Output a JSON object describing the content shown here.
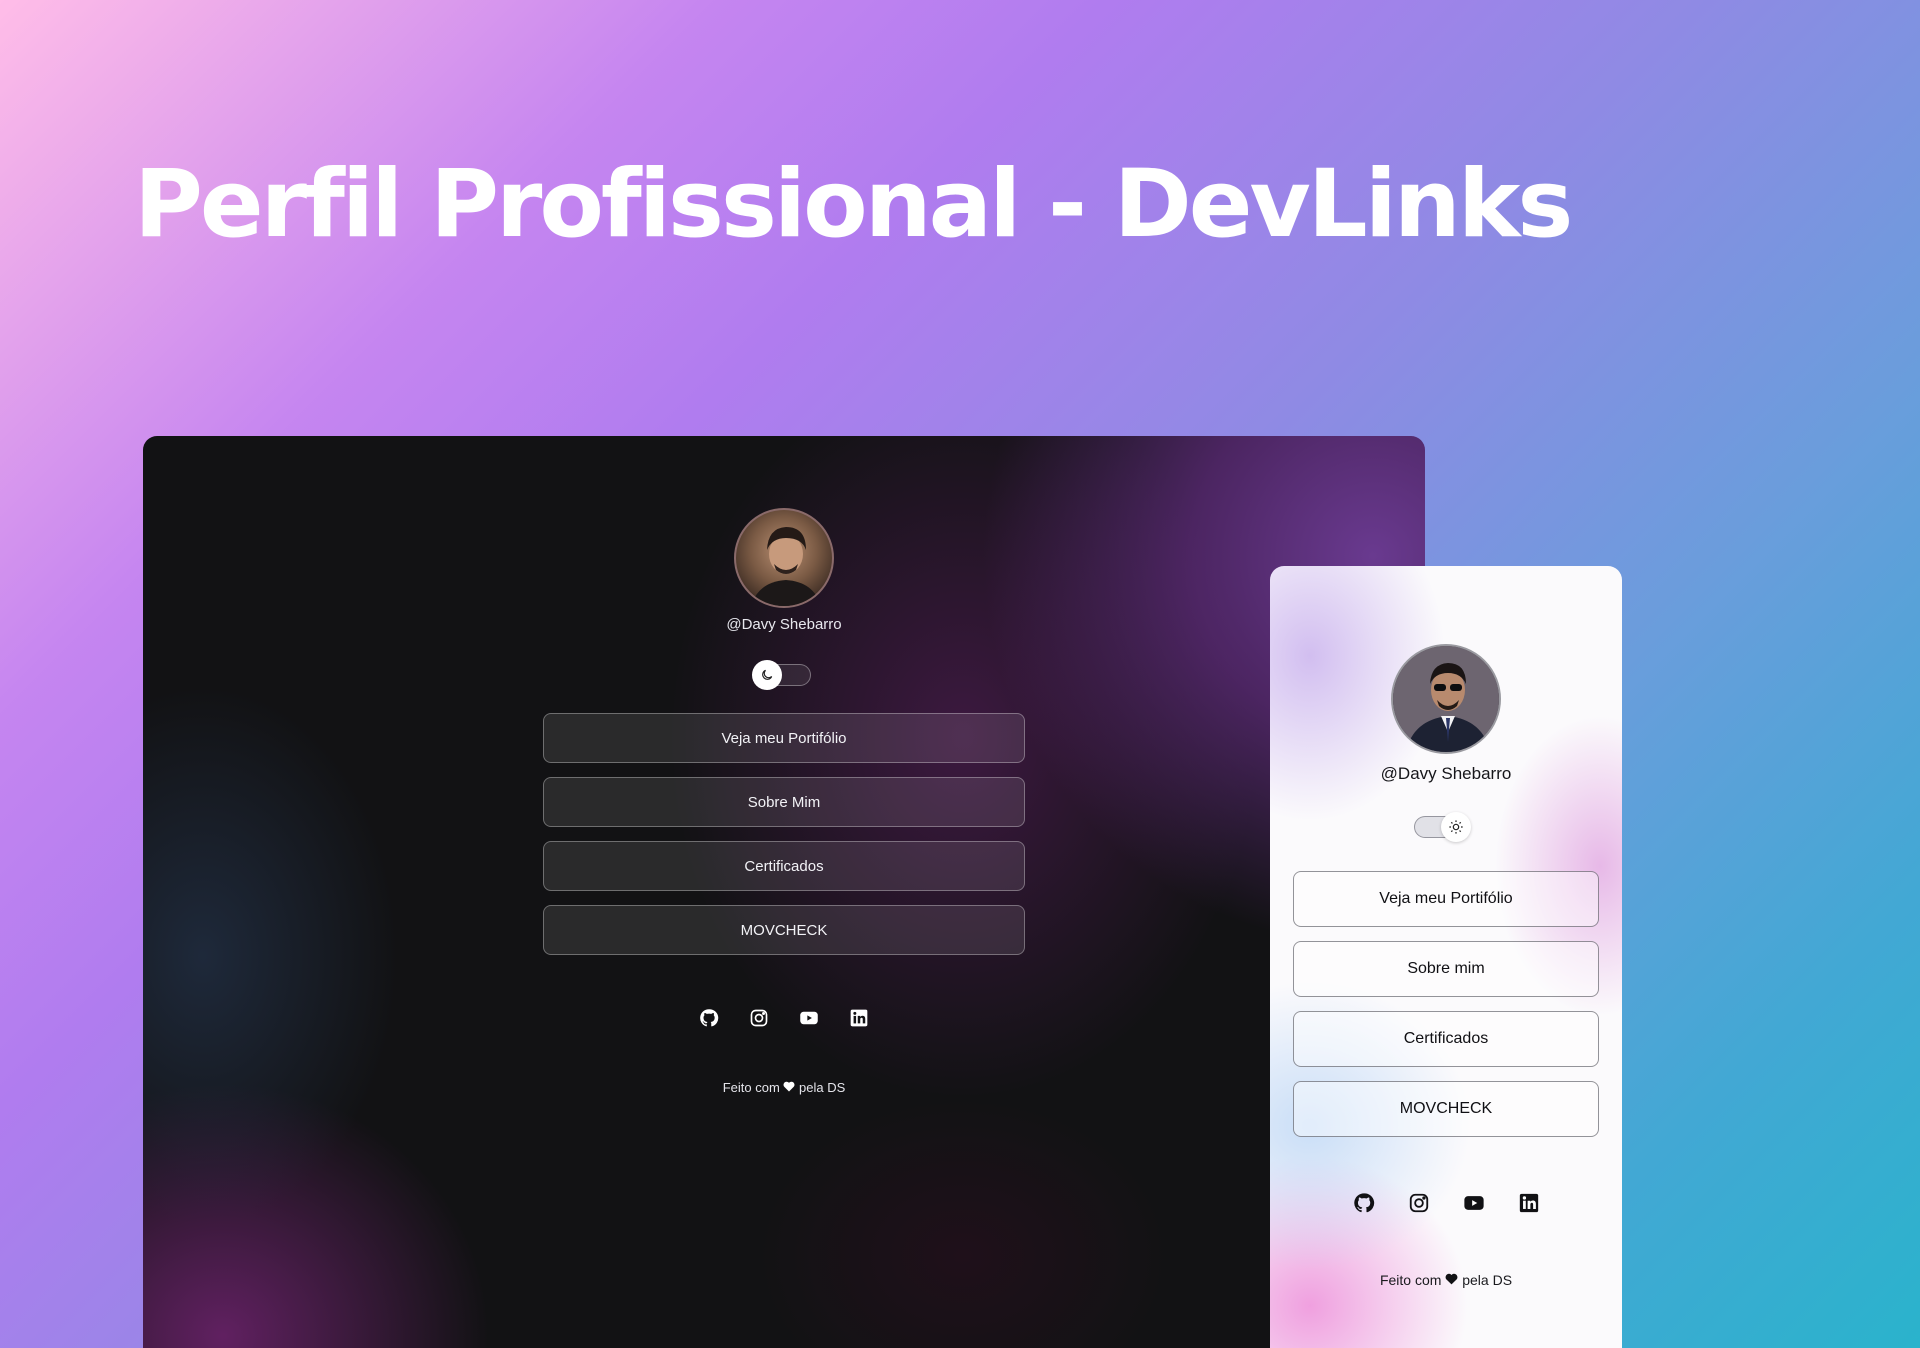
{
  "page": {
    "title": "Perfil Profissional - DevLinks"
  },
  "dark_mockup": {
    "handle": "@Davy Shebarro",
    "theme": "dark",
    "toggle_icon": "moon-icon",
    "links": [
      {
        "label": "Veja meu Portifólio"
      },
      {
        "label": "Sobre Mim"
      },
      {
        "label": "Certificados"
      },
      {
        "label": "MOVCHECK"
      }
    ],
    "social": [
      "github-icon",
      "instagram-icon",
      "youtube-icon",
      "linkedin-icon"
    ],
    "footer": {
      "before": "Feito com",
      "after": "pela DS"
    }
  },
  "light_mockup": {
    "handle": "@Davy Shebarro",
    "theme": "light",
    "toggle_icon": "sun-icon",
    "links": [
      {
        "label": "Veja meu Portifólio"
      },
      {
        "label": "Sobre mim"
      },
      {
        "label": "Certificados"
      },
      {
        "label": "MOVCHECK"
      }
    ],
    "social": [
      "github-icon",
      "instagram-icon",
      "youtube-icon",
      "linkedin-icon"
    ],
    "footer": {
      "before": "Feito com",
      "after": "pela DS"
    }
  },
  "colors": {
    "background_start": "#ffbde8",
    "background_mid": "#b07cef",
    "background_end": "#2ab3cc",
    "dark_surface": "#121214",
    "light_surface": "#fbfafc"
  }
}
